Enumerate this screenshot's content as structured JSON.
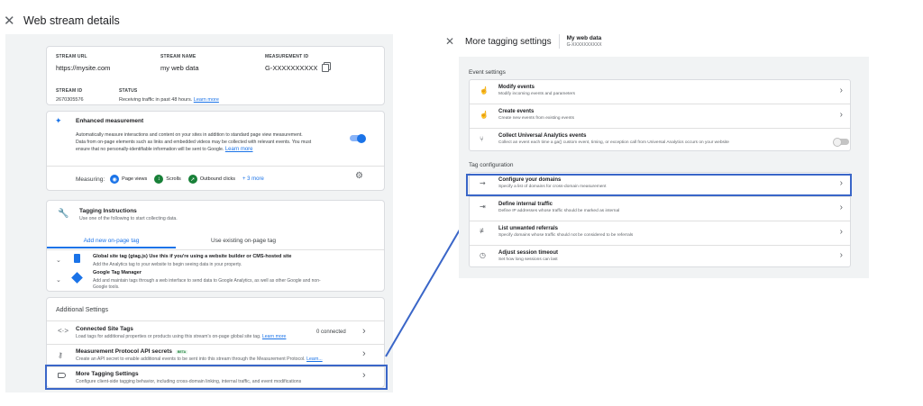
{
  "left": {
    "header": {
      "close_icon": "close-icon",
      "title": "Web stream details"
    },
    "stream": {
      "url_label": "STREAM URL",
      "url_value": "https://mysite.com",
      "name_label": "STREAM NAME",
      "name_value": "my web data",
      "measurement_label": "MEASUREMENT ID",
      "measurement_value": "G-XXXXXXXXXX",
      "id_label": "STREAM ID",
      "id_value": "2670305576",
      "status_label": "STATUS",
      "status_value": "Receiving traffic in past 48 hours.",
      "status_link": "Learn more"
    },
    "enhanced": {
      "title": "Enhanced measurement",
      "desc_1": "Automatically measure interactions and content on your sites in addition to standard page view measurement.",
      "desc_2": "Data from on-page elements such as links and embedded videos may be collected with relevant events. You must",
      "desc_3": "ensure that no personally-identifiable information will be sent to Google.",
      "learn_more": "Learn more",
      "toggle_on": true,
      "measuring_label": "Measuring:",
      "chips": [
        "Page views",
        "Scrolls",
        "Outbound clicks"
      ],
      "more": "+ 3 more"
    },
    "tagging": {
      "title": "Tagging Instructions",
      "desc": "Use one of the following to start collecting data.",
      "tab_new": "Add new on-page tag",
      "tab_existing": "Use existing on-page tag",
      "items": [
        {
          "title": "Global site tag (gtag.js) Use this if you're using a website builder or CMS-hosted site",
          "desc": "Add the Analytics tag to your website to begin seeing data in your property."
        },
        {
          "title": "Google Tag Manager",
          "desc_1": "Add and maintain tags through a web interface to send data to Google Analytics, as well as other Google and non-",
          "desc_2": "Google tools."
        }
      ]
    },
    "additional": {
      "title": "Additional Settings",
      "rows": [
        {
          "title": "Connected Site Tags",
          "desc": "Load tags for additional properties or products using this stream's on-page global site tag.",
          "link": "Learn more",
          "trailing": "0 connected"
        },
        {
          "title": "Measurement Protocol API secrets",
          "badge": "BETA",
          "desc": "Create an API secret to enable additional events to be sent into this stream through the Measurement Protocol.",
          "link": "Learn..."
        },
        {
          "title": "More Tagging Settings",
          "desc": "Configure client-side tagging behavior, including cross-domain linking, internal traffic, and event modifications"
        }
      ]
    }
  },
  "right": {
    "header": {
      "title": "More tagging settings",
      "stream_name": "My web data",
      "stream_id": "G-XXXXXXXXXX"
    },
    "event_settings_label": "Event settings",
    "event_rows": [
      {
        "title": "Modify events",
        "desc": "Modify incoming events and parameters",
        "icon": "touch-icon"
      },
      {
        "title": "Create events",
        "desc": "Create new events from existing events",
        "icon": "touch-icon"
      },
      {
        "title": "Collect Universal Analytics events",
        "desc": "Collect an event each time a ga() custom event, timing, or exception call from Universal Analytics occurs on your website",
        "icon": "fork-icon",
        "toggle_on": false
      }
    ],
    "tag_config_label": "Tag configuration",
    "tag_rows": [
      {
        "title": "Configure your domains",
        "desc": "Specify a list of domains for cross-domain measurement",
        "icon": "domains-icon"
      },
      {
        "title": "Define internal traffic",
        "desc": "Define IP addresses whose traffic should be marked as internal",
        "icon": "enter-icon"
      },
      {
        "title": "List unwanted referrals",
        "desc": "Specify domains whose traffic should not be considered to be referrals",
        "icon": "filter-icon"
      },
      {
        "title": "Adjust session timeout",
        "desc": "Set how long sessions can last",
        "icon": "clock-icon"
      }
    ]
  },
  "colors": {
    "accent": "#1a73e8",
    "highlight": "#3a66c8",
    "panel_bg": "#f1f3f4"
  }
}
